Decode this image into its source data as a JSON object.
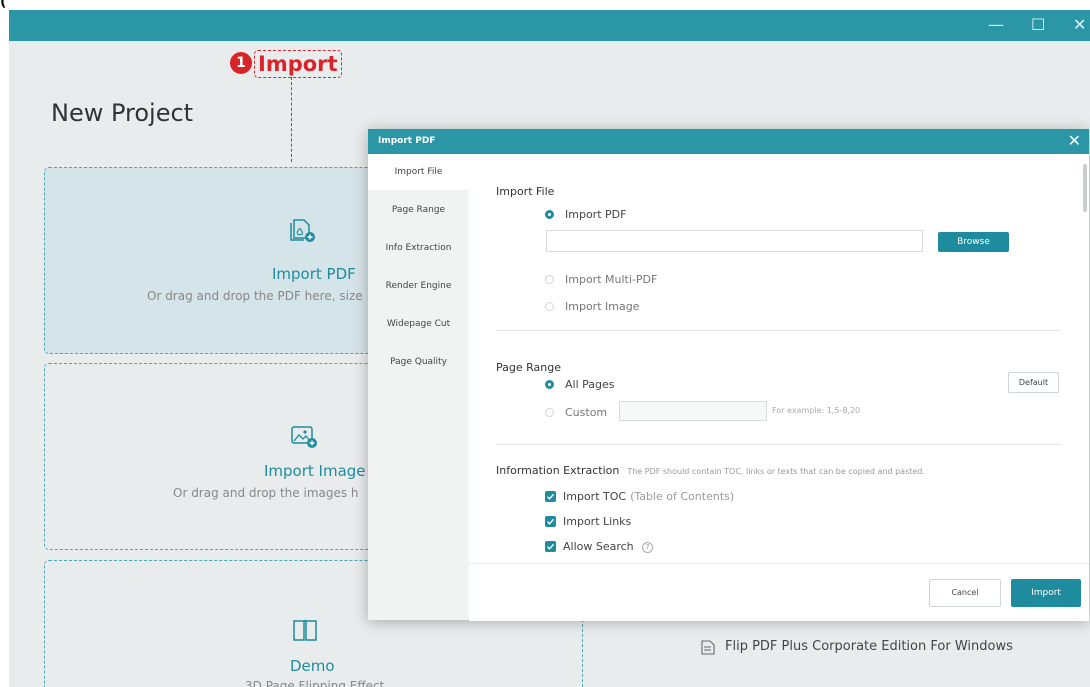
{
  "caption_fragment": "(",
  "window": {
    "controls": {
      "minimize": "—",
      "maximize": "☐",
      "close": "✕"
    }
  },
  "page": {
    "title": "New Project"
  },
  "callout": {
    "number": "1",
    "label": "Import"
  },
  "cards": [
    {
      "title": "Import PDF",
      "desc": "Or drag and drop the PDF here, size"
    },
    {
      "title": "Import Image",
      "desc": "Or drag and drop the images h"
    },
    {
      "title": "Demo",
      "desc": "3D Page Flipping Effect"
    }
  ],
  "recent": [
    {
      "label": "Flip PDF Plus Corporate Edition For Windows"
    }
  ],
  "dialog": {
    "title": "Import PDF",
    "close": "✕",
    "nav": [
      {
        "label": "Import File"
      },
      {
        "label": "Page Range"
      },
      {
        "label": "Info Extraction"
      },
      {
        "label": "Render Engine"
      },
      {
        "label": "Widepage Cut"
      },
      {
        "label": "Page Quality"
      }
    ],
    "import_file": {
      "title": "Import File",
      "opt_pdf": "Import PDF",
      "path_value": "",
      "browse": "Browse",
      "opt_multi": "Import Multi-PDF",
      "opt_image": "Import Image"
    },
    "page_range": {
      "title": "Page Range",
      "default": "Default",
      "opt_all": "All Pages",
      "opt_custom": "Custom",
      "custom_value": "",
      "example": "For example: 1,5-8,20"
    },
    "info": {
      "title": "Information Extraction",
      "note": "The PDF should contain TOC, links or texts that can be copied and pasted.",
      "toc": "Import TOC",
      "toc_sub": "(Table of Contents)",
      "links": "Import Links",
      "search": "Allow Search",
      "help": "?"
    },
    "footer": {
      "cancel": "Cancel",
      "import": "Import"
    }
  },
  "colors": {
    "accent": "#2b96a6",
    "accent_dark": "#1e8c9e",
    "callout": "#d9242a"
  }
}
